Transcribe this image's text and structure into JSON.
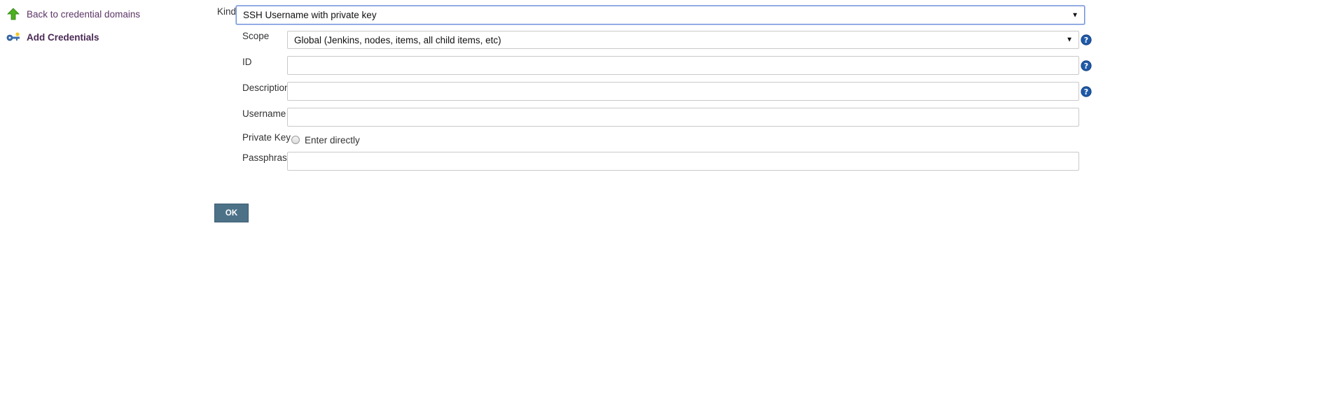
{
  "sidebar": {
    "items": [
      {
        "label": "Back to credential domains",
        "icon": "up-arrow-icon"
      },
      {
        "label": "Add Credentials",
        "icon": "key-icon"
      }
    ]
  },
  "form": {
    "kind": {
      "label": "Kind",
      "value": "SSH Username with private key"
    },
    "scope": {
      "label": "Scope",
      "value": "Global (Jenkins, nodes, items, all child items, etc)"
    },
    "id": {
      "label": "ID",
      "value": ""
    },
    "description": {
      "label": "Description",
      "value": ""
    },
    "username": {
      "label": "Username",
      "value": ""
    },
    "private_key": {
      "label": "Private Key",
      "option_label": "Enter directly",
      "selected": false
    },
    "passphrase": {
      "label": "Passphrase",
      "value": ""
    },
    "ok_label": "OK"
  },
  "colors": {
    "link": "#5c3566",
    "button": "#4d7288",
    "help": "#1f5aa8",
    "arrow_icon": "#4caf1e"
  }
}
